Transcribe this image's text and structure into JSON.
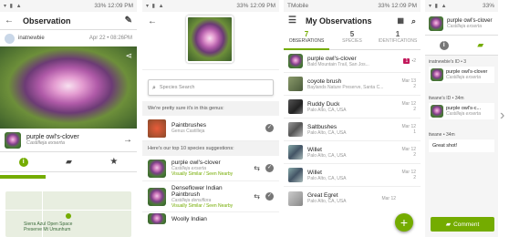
{
  "status": {
    "time": "12:09 PM",
    "battery": "33%",
    "carrier": "TMobile",
    "icons": "▾ ▮ ▲"
  },
  "s1": {
    "title": "Observation",
    "user": "inatnewbie",
    "date": "Apr 22 • 08:26PM",
    "taxon_name": "purple owl's-clover",
    "taxon_sci": "Castilleja exserta",
    "place_line1": "Sierra Azul Open Space",
    "place_line2": "Preserve Mt Umunhum"
  },
  "s2": {
    "search_placeholder": "Species Search",
    "genus_msg": "We're pretty sure it's in this genus:",
    "genus_name": "Paintbrushes",
    "genus_sci": "Genus Castilleja",
    "suggest_msg": "Here's our top 10 species suggestions:",
    "suggestions": [
      {
        "name": "purple owl's-clover",
        "sci": "Castilleja exserta",
        "tag": "Visually Similar / Seen Nearby"
      },
      {
        "name": "Denseflower Indian Paintbrush",
        "sci": "Castilleja densiflora",
        "tag": "Visually Similar / Seen Nearby"
      },
      {
        "name": "Woolly Indian",
        "sci": "",
        "tag": ""
      }
    ]
  },
  "s3": {
    "title": "My Observations",
    "tabs": [
      {
        "count": "7",
        "label": "OBSERVATIONS"
      },
      {
        "count": "5",
        "label": "SPECIES"
      },
      {
        "count": "1",
        "label": "IDENTIFICATIONS"
      }
    ],
    "items": [
      {
        "name": "purple owl's-clover",
        "place": "Bald Mountain Trail, San Jos...",
        "date": "",
        "meta": "1  2"
      },
      {
        "name": "coyote brush",
        "place": "Baylands Nature Preserve, Santa C...",
        "date": "Mar 13",
        "meta": "2"
      },
      {
        "name": "Ruddy Duck",
        "place": "Palo Alto, CA, USA",
        "date": "Mar 12",
        "meta": "2"
      },
      {
        "name": "Saltbushes",
        "place": "Palo Alto, CA, USA",
        "date": "Mar 12",
        "meta": "1"
      },
      {
        "name": "Willet",
        "place": "Palo Alto, CA, USA",
        "date": "Mar 12",
        "meta": "2"
      },
      {
        "name": "Willet",
        "place": "Palo Alto, CA, USA",
        "date": "Mar 12",
        "meta": "2"
      },
      {
        "name": "Great Egret",
        "place": "Palo Alto, CA, USA",
        "date": "Mar 12",
        "meta": ""
      }
    ],
    "fab": "+"
  },
  "s4": {
    "activity": [
      {
        "user": "inatnewbie's ID • 3",
        "name": "purple owl's-clover",
        "sci": "Castilleja exserta"
      },
      {
        "user": "tiwane's ID • 34m",
        "name": "purple owl's-c...",
        "sci": "Castilleja exserta"
      },
      {
        "user": "tiwane • 34m",
        "name": "Great shot!",
        "sci": ""
      }
    ],
    "comment_btn": "Comment"
  }
}
